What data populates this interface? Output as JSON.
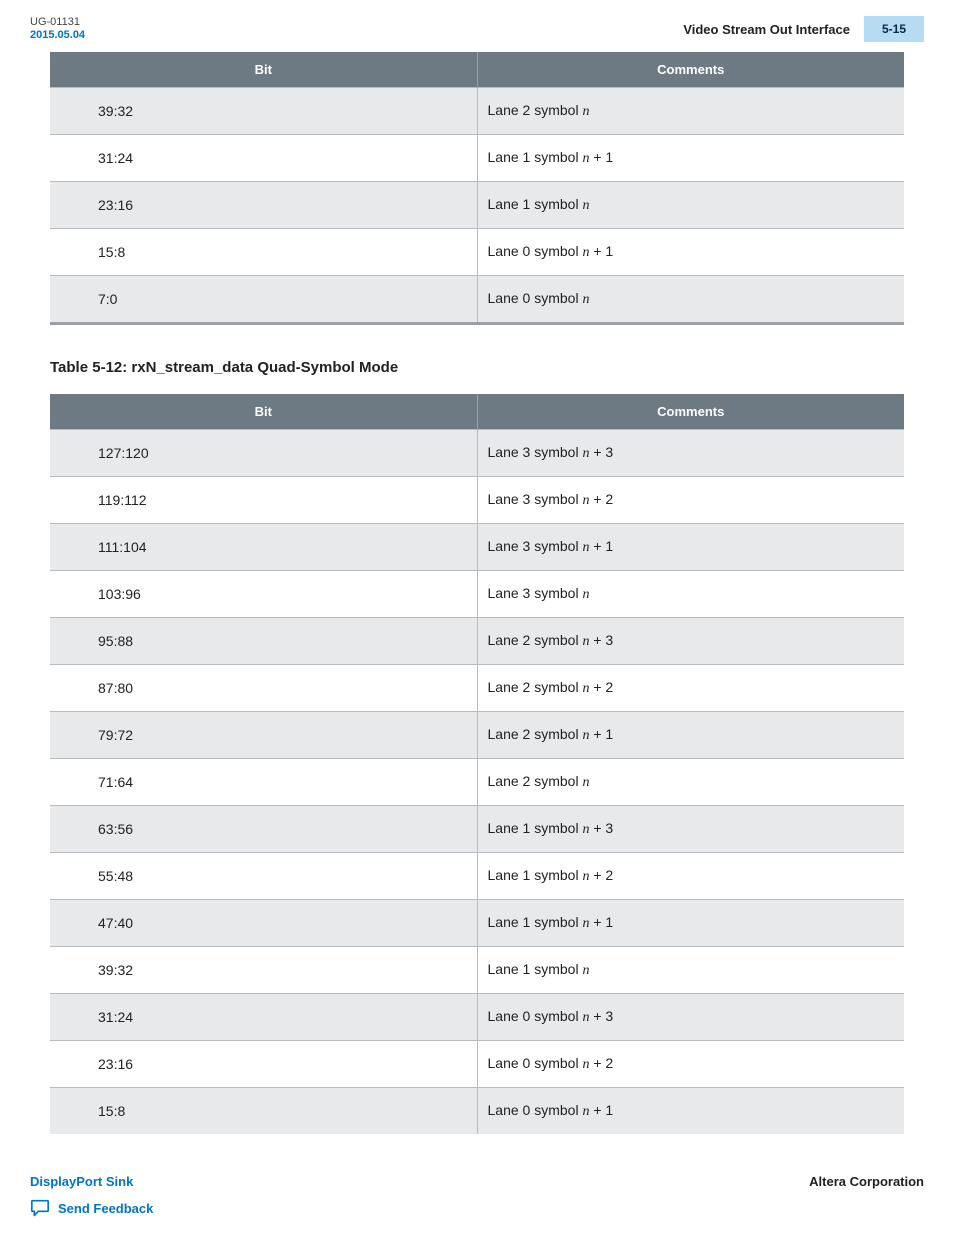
{
  "header": {
    "doc_id_line1": "UG-01131",
    "doc_id_line2": "2015.05.04",
    "section_title": "Video Stream Out Interface",
    "page_badge": "5-15"
  },
  "table1": {
    "headers": {
      "bit": "Bit",
      "comments": "Comments"
    },
    "rows": [
      {
        "bit": "39:32",
        "lane": "Lane 2 symbol ",
        "suffix": "n"
      },
      {
        "bit": "31:24",
        "lane": "Lane 1 symbol ",
        "suffix": "n + 1"
      },
      {
        "bit": "23:16",
        "lane": "Lane 1 symbol ",
        "suffix": "n"
      },
      {
        "bit": "15:8",
        "lane": "Lane 0 symbol ",
        "suffix": "n + 1"
      },
      {
        "bit": "7:0",
        "lane": "Lane 0 symbol ",
        "suffix": "n"
      }
    ]
  },
  "table2_caption": "Table 5-12: rxN_stream_data Quad-Symbol Mode",
  "table2": {
    "headers": {
      "bit": "Bit",
      "comments": "Comments"
    },
    "rows": [
      {
        "bit": "127:120",
        "lane": "Lane 3 symbol ",
        "suffix": "n + 3"
      },
      {
        "bit": "119:112",
        "lane": "Lane 3 symbol ",
        "suffix": "n + 2"
      },
      {
        "bit": "111:104",
        "lane": "Lane 3 symbol ",
        "suffix": "n + 1"
      },
      {
        "bit": "103:96",
        "lane": "Lane 3 symbol ",
        "suffix": "n"
      },
      {
        "bit": "95:88",
        "lane": "Lane 2 symbol ",
        "suffix": "n + 3"
      },
      {
        "bit": "87:80",
        "lane": "Lane 2 symbol ",
        "suffix": "n + 2"
      },
      {
        "bit": "79:72",
        "lane": "Lane 2 symbol ",
        "suffix": "n + 1"
      },
      {
        "bit": "71:64",
        "lane": "Lane 2 symbol ",
        "suffix": "n"
      },
      {
        "bit": "63:56",
        "lane": "Lane 1 symbol ",
        "suffix": "n + 3"
      },
      {
        "bit": "55:48",
        "lane": "Lane 1 symbol ",
        "suffix": "n + 2"
      },
      {
        "bit": "47:40",
        "lane": "Lane 1 symbol ",
        "suffix": "n + 1"
      },
      {
        "bit": "39:32",
        "lane": "Lane 1 symbol ",
        "suffix": "n"
      },
      {
        "bit": "31:24",
        "lane": "Lane 0 symbol ",
        "suffix": "n + 3"
      },
      {
        "bit": "23:16",
        "lane": "Lane 0 symbol ",
        "suffix": "n + 2"
      },
      {
        "bit": "15:8",
        "lane": "Lane 0 symbol ",
        "suffix": "n + 1"
      }
    ]
  },
  "footer": {
    "sink_link": "DisplayPort Sink",
    "feedback_link": "Send Feedback",
    "corporation": "Altera Corporation"
  }
}
